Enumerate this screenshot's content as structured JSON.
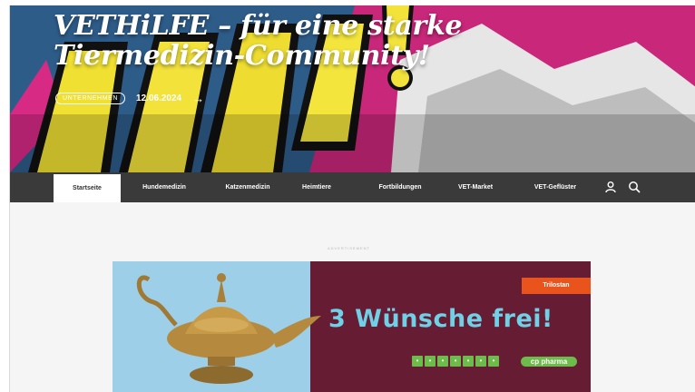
{
  "hero": {
    "title_line1": "VETHiLFE – für eine starke",
    "title_line2": "Tiermedizin-Community!",
    "category": "Unternehmen",
    "date": "12.06.2024",
    "arrow": "→"
  },
  "nav": {
    "items": [
      {
        "label": "Startseite",
        "active": true
      },
      {
        "label": "Hundemedizin"
      },
      {
        "label": "Katzenmedizin"
      },
      {
        "label": "Heimtiere"
      },
      {
        "label": "Fortbildungen"
      },
      {
        "label": "VET-Market"
      },
      {
        "label": "VET-Geflüster"
      }
    ],
    "user_icon": "user-icon",
    "search_icon": "search-icon"
  },
  "ad": {
    "label": "Advertisement",
    "brand": "Trilostan",
    "headline": "3 Wünsche frei!",
    "logo": "cp pharma",
    "colors": {
      "background": "#661d33",
      "sky": "#9dcfe8",
      "accent": "#e8541c",
      "headline": "#6fd0e6",
      "green": "#6dbb4a"
    }
  }
}
